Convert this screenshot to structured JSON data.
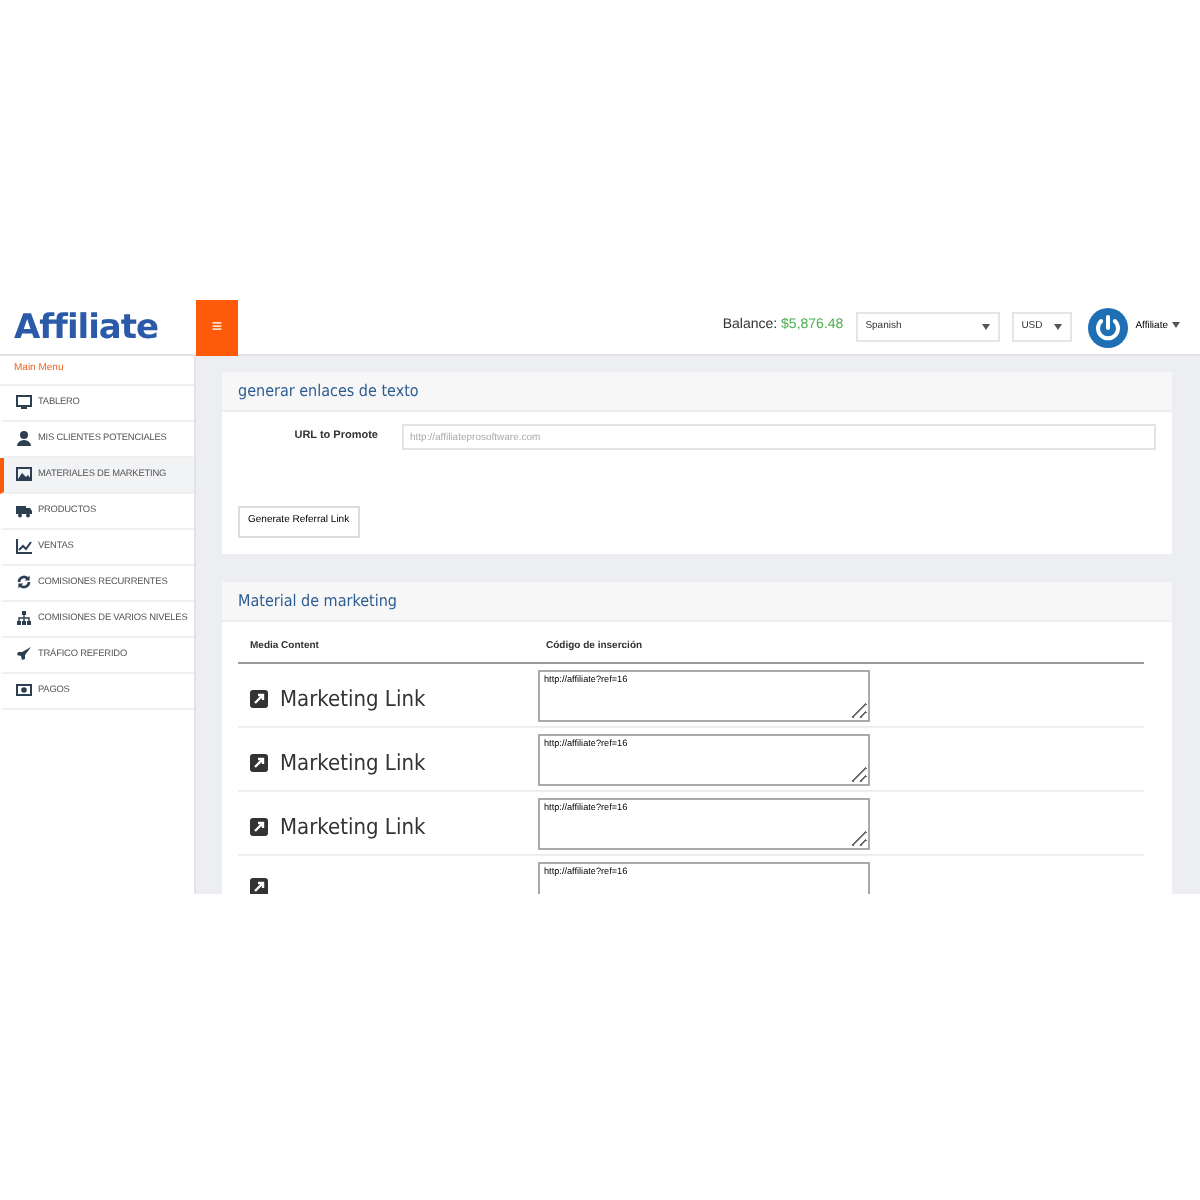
{
  "logo": "Affiliate",
  "topbar": {
    "menu_toggle": "≡",
    "balance_label": "Balance:",
    "balance_value": "$5,876.48",
    "language": "Spanish",
    "currency": "USD",
    "user": "Affiliate"
  },
  "sidebar": {
    "heading": "Main Menu",
    "items": [
      {
        "label": "TABLERO",
        "selected": false
      },
      {
        "label": "MIS CLIENTES POTENCIALES",
        "selected": false
      },
      {
        "label": "MATERIALES DE MARKETING",
        "selected": true
      },
      {
        "label": "PRODUCTOS",
        "selected": false
      },
      {
        "label": "VENTAS",
        "selected": false
      },
      {
        "label": "COMISIONES RECURRENTES",
        "selected": false
      },
      {
        "label": "COMISIONES DE VARIOS NIVELES",
        "selected": false
      },
      {
        "label": "TRÁFICO REFERIDO",
        "selected": false
      },
      {
        "label": "PAGOS",
        "selected": false
      }
    ]
  },
  "text_links": {
    "title": "generar enlaces de texto",
    "url_label": "URL to Promote",
    "url_placeholder": "http://affiliateprosoftware.com",
    "button": "Generate Referral Link"
  },
  "marketing": {
    "title": "Material de marketing",
    "columns": [
      "Media Content",
      "Código de inserción"
    ],
    "rows": [
      {
        "label": "Marketing Link",
        "code": "http://affiliate?ref=16"
      },
      {
        "label": "Marketing Link",
        "code": "http://affiliate?ref=16"
      },
      {
        "label": "Marketing Link",
        "code": "http://affiliate?ref=16"
      },
      {
        "code": "http://affiliate?ref=16"
      }
    ]
  }
}
